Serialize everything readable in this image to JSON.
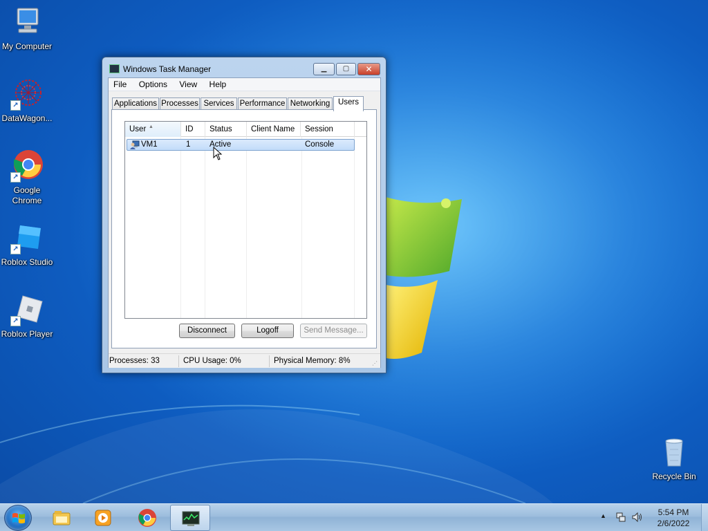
{
  "desktop": {
    "icons": [
      {
        "label": "My Computer"
      },
      {
        "label": "DataWagon..."
      },
      {
        "label": "Google Chrome"
      },
      {
        "label": "Roblox Studio"
      },
      {
        "label": "Roblox Player"
      },
      {
        "label": "Recycle Bin"
      }
    ]
  },
  "taskmgr": {
    "title": "Windows Task Manager",
    "menu": [
      "File",
      "Options",
      "View",
      "Help"
    ],
    "tabs": [
      "Applications",
      "Processes",
      "Services",
      "Performance",
      "Networking",
      "Users"
    ],
    "active_tab": "Users",
    "columns": [
      "User",
      "ID",
      "Status",
      "Client Name",
      "Session"
    ],
    "rows": [
      {
        "user": "VM1",
        "id": "1",
        "status": "Active",
        "client_name": "",
        "session": "Console"
      }
    ],
    "buttons": {
      "disconnect": "Disconnect",
      "logoff": "Logoff",
      "send_message": "Send Message..."
    },
    "status": {
      "processes": "Processes: 33",
      "cpu": "CPU Usage: 0%",
      "memory": "Physical Memory: 8%"
    }
  },
  "taskbar": {
    "time": "5:54 PM",
    "date": "2/6/2022",
    "pinned": [
      "windows-explorer-icon",
      "media-player-icon",
      "chrome-icon",
      "task-manager-icon"
    ]
  },
  "colors": {
    "accent": "#1c78d8",
    "selection": "#c2dcfa"
  }
}
